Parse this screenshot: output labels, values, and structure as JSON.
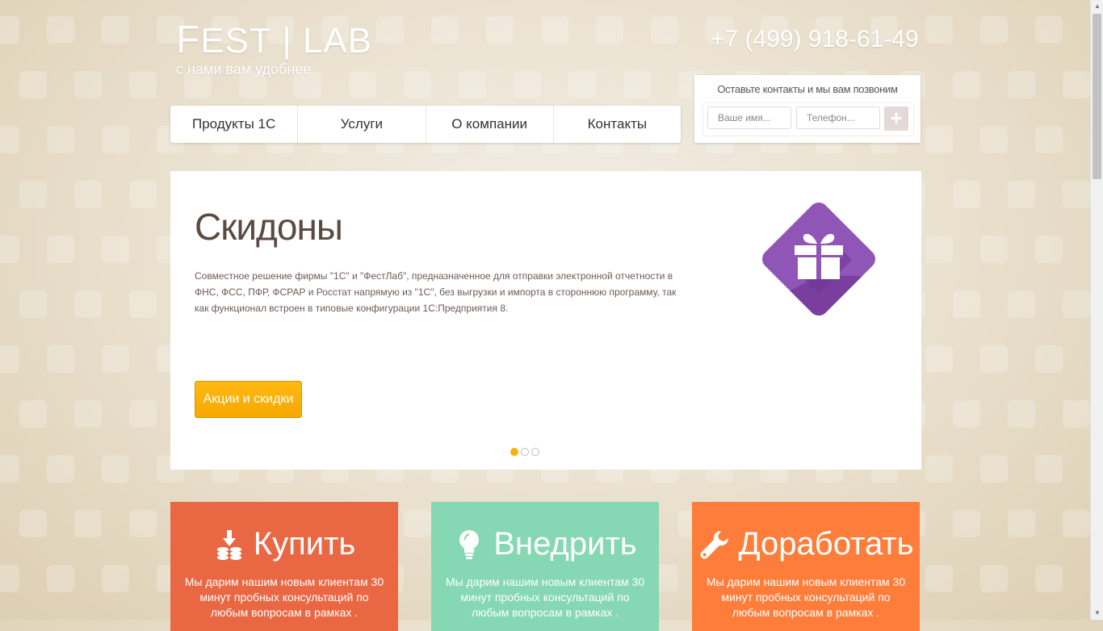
{
  "logo": {
    "title_first": "F",
    "title_rest": "EST | LAB",
    "subtitle": "с нами вам удобнее"
  },
  "phone": "+7 (499) 918-61-49",
  "nav": {
    "items": [
      {
        "label": "Продукты 1С"
      },
      {
        "label": "Услуги"
      },
      {
        "label": "О компании"
      },
      {
        "label": "Контакты"
      }
    ]
  },
  "callback": {
    "title": "Оставьте контакты и мы вам позвоним",
    "name_placeholder": "Ваше имя...",
    "phone_placeholder": "Телефон...",
    "submit_label": "+"
  },
  "slider": {
    "title": "Скидоны",
    "text": "Совместное решение фирмы \"1С\" и \"ФестЛаб\", предназначенное для отправки электронной отчетности в ФНС, ФСС, ПФР, ФСРАР и Росстат напрямую из \"1С\", без выгрузки и импорта в стороннюю программу, так как функционал встроен в типовые конфигурации 1С:Предприятия 8.",
    "button_label": "Акции и скидки",
    "icon": "gift-icon",
    "icon_color": "#8a4fb0",
    "active_slide": 1,
    "slide_count": 3
  },
  "cards": [
    {
      "title": "Купить",
      "icon": "coins-download-icon",
      "color": "#ea6744",
      "text": "Мы дарим нашим новым клиентам 30 минут пробных консультаций по любым вопросам в рамках ."
    },
    {
      "title": "Внедрить",
      "icon": "lightbulb-icon",
      "color": "#86d7b3",
      "text": "Мы дарим нашим новым клиентам 30 минут пробных консультаций по любым вопросам в рамках ."
    },
    {
      "title": "Доработать",
      "icon": "wrench-icon",
      "color": "#ff7d3a",
      "text": "Мы дарим нашим новым клиентам 30 минут пробных консультаций по любым вопросам в рамках ."
    }
  ]
}
